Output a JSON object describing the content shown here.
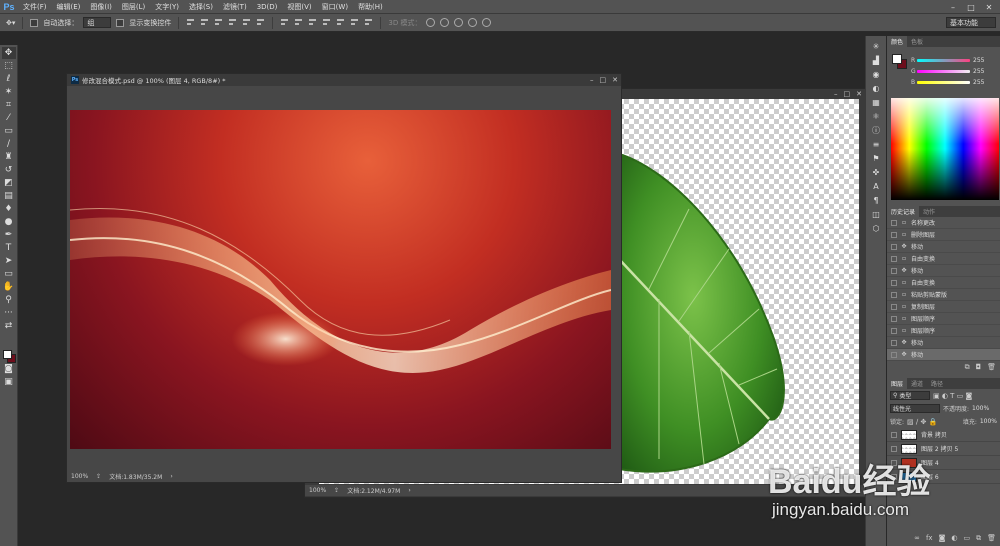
{
  "app": {
    "logo": "Ps"
  },
  "menu": [
    "文件(F)",
    "编辑(E)",
    "图像(I)",
    "图层(L)",
    "文字(Y)",
    "选择(S)",
    "滤镜(T)",
    "3D(D)",
    "视图(V)",
    "窗口(W)",
    "帮助(H)"
  ],
  "options_bar": {
    "auto_select_label": "自动选择：",
    "auto_select_value": "组",
    "show_transform_label": "显示变换控件",
    "mode_3d_label": "3D 模式：",
    "workspace": "基本功能"
  },
  "front_doc": {
    "title": "修改混合模式.psd @ 100% (图层 4, RGB/8#) *",
    "zoom": "100%",
    "doc_info": "文档:1.83M/35.2M"
  },
  "back_doc": {
    "zoom": "100%",
    "doc_info": "文档:2.12M/4.97M"
  },
  "color_panel": {
    "tabs": [
      "颜色",
      "色板"
    ],
    "sliders": [
      {
        "label": "R",
        "value": "255",
        "color": "#ff4040"
      },
      {
        "label": "G",
        "value": "255",
        "color": "#e040e0"
      },
      {
        "label": "B",
        "value": "255",
        "color": "#e0e000"
      }
    ],
    "foreground": "#ffffff",
    "background": "#6d0e1c"
  },
  "history_panel": {
    "tabs": [
      "历史记录",
      "动作"
    ],
    "items": [
      "名称更改",
      "删除图层",
      "移动",
      "自由变换",
      "移动",
      "自由变换",
      "粘贴剪贴蒙版",
      "复制图层",
      "图层顺序",
      "图层顺序",
      "移动",
      "移动"
    ]
  },
  "layers_panel": {
    "tabs": [
      "图层",
      "通道",
      "路径"
    ],
    "filter_label": "类型",
    "blend_mode": "线性光",
    "opacity_label": "不透明度:",
    "opacity_value": "100%",
    "lock_label": "锁定:",
    "fill_label": "填充:",
    "fill_value": "100%",
    "layers": [
      "背景 拷贝",
      "图层 2 拷贝 5",
      "图层 4",
      "图层 6"
    ]
  },
  "watermark": {
    "brand": "Baidu经验",
    "url": "jingyan.baidu.com"
  }
}
